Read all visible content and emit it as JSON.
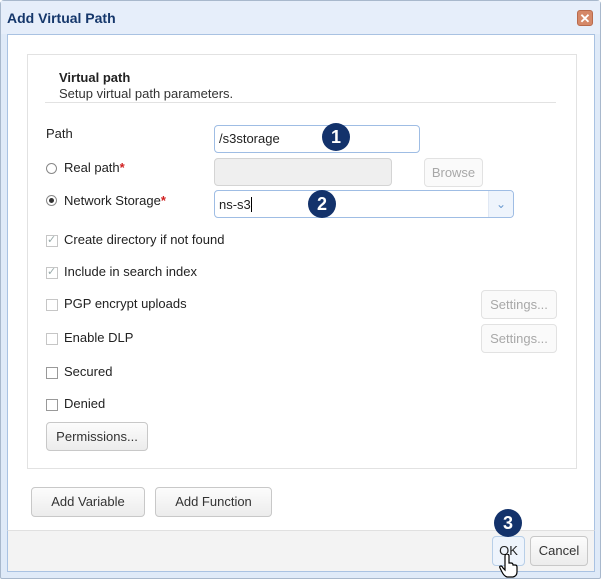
{
  "window": {
    "title": "Add Virtual Path",
    "close_icon": "close-icon"
  },
  "section": {
    "title": "Virtual path",
    "subtitle": "Setup virtual path parameters."
  },
  "form": {
    "path_label": "Path",
    "path_value": "/s3storage",
    "real_path_label": "Real path",
    "real_path_value": "",
    "real_path_selected": false,
    "browse_label": "Browse",
    "network_storage_label": "Network Storage",
    "network_storage_value": "ns-s3",
    "network_storage_selected": true,
    "required_marker": "*",
    "dropdown_icon": "chevron-down-icon"
  },
  "options": [
    {
      "label": "Create directory if not found",
      "checked": true,
      "disabled": true
    },
    {
      "label": "Include in search index",
      "checked": true,
      "disabled": true
    },
    {
      "label": "PGP encrypt uploads",
      "checked": false,
      "disabled": true,
      "settings_label": "Settings..."
    },
    {
      "label": "Enable DLP",
      "checked": false,
      "disabled": true,
      "settings_label": "Settings..."
    },
    {
      "label": "Secured",
      "checked": false,
      "disabled": false
    },
    {
      "label": "Denied",
      "checked": false,
      "disabled": false
    }
  ],
  "permissions_label": "Permissions...",
  "bottom_buttons": {
    "add_variable": "Add Variable",
    "add_function": "Add Function"
  },
  "footer": {
    "ok": "OK",
    "cancel": "Cancel"
  },
  "annotations": [
    "1",
    "2",
    "3"
  ],
  "colors": {
    "badge": "#13326b",
    "title_text": "#15376b",
    "close_button": "#d58868",
    "required": "#d02020",
    "input_border": "#9fbde4"
  }
}
